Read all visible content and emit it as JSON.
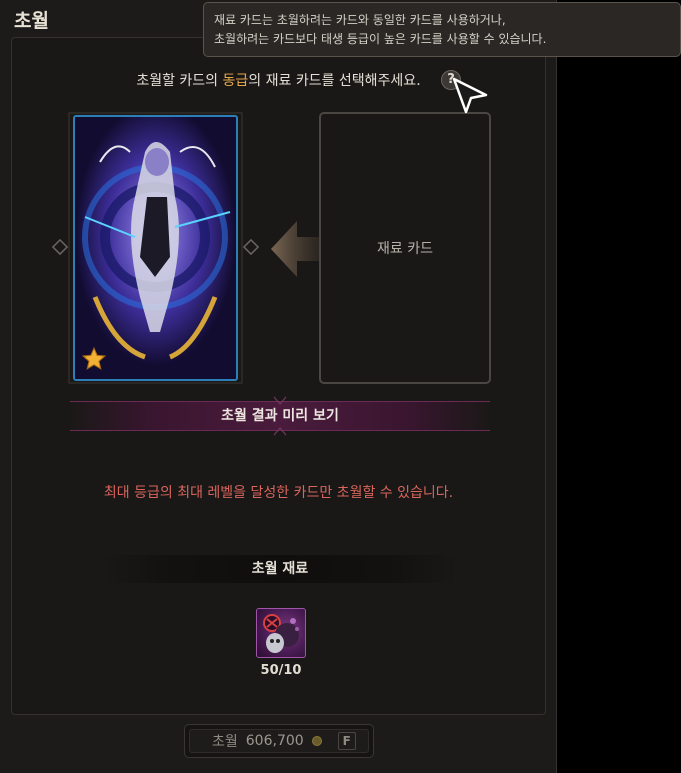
{
  "window": {
    "title": "초월"
  },
  "tooltip": {
    "line1": "재료 카드는 초월하려는 카드와 동일한 카드를 사용하거나,",
    "line2": "초월하려는 카드보다 태생 등급이 높은 카드를 사용할 수 있습니다."
  },
  "instruction": {
    "prefix": "초월할 카드의 ",
    "highlight": "동급",
    "suffix": "의 재료 카드를 선택해주세요.",
    "help_symbol": "?"
  },
  "material_slot": {
    "label": "재료 카드"
  },
  "preview": {
    "label": "초월 결과 미리 보기"
  },
  "warning": {
    "text": "최대 등급의 최대 레벨을 달성한 카드만 초월할 수 있습니다."
  },
  "materials": {
    "header": "초월 재료",
    "items": [
      {
        "icon": "transcend-material-icon",
        "count": "50/10"
      }
    ]
  },
  "currency": {
    "label": "초월",
    "amount": "606,700",
    "hotkey": "F"
  },
  "colors": {
    "accent": "#e7a94a",
    "warning": "#d9655c",
    "card_border": "#2d7fb8"
  }
}
